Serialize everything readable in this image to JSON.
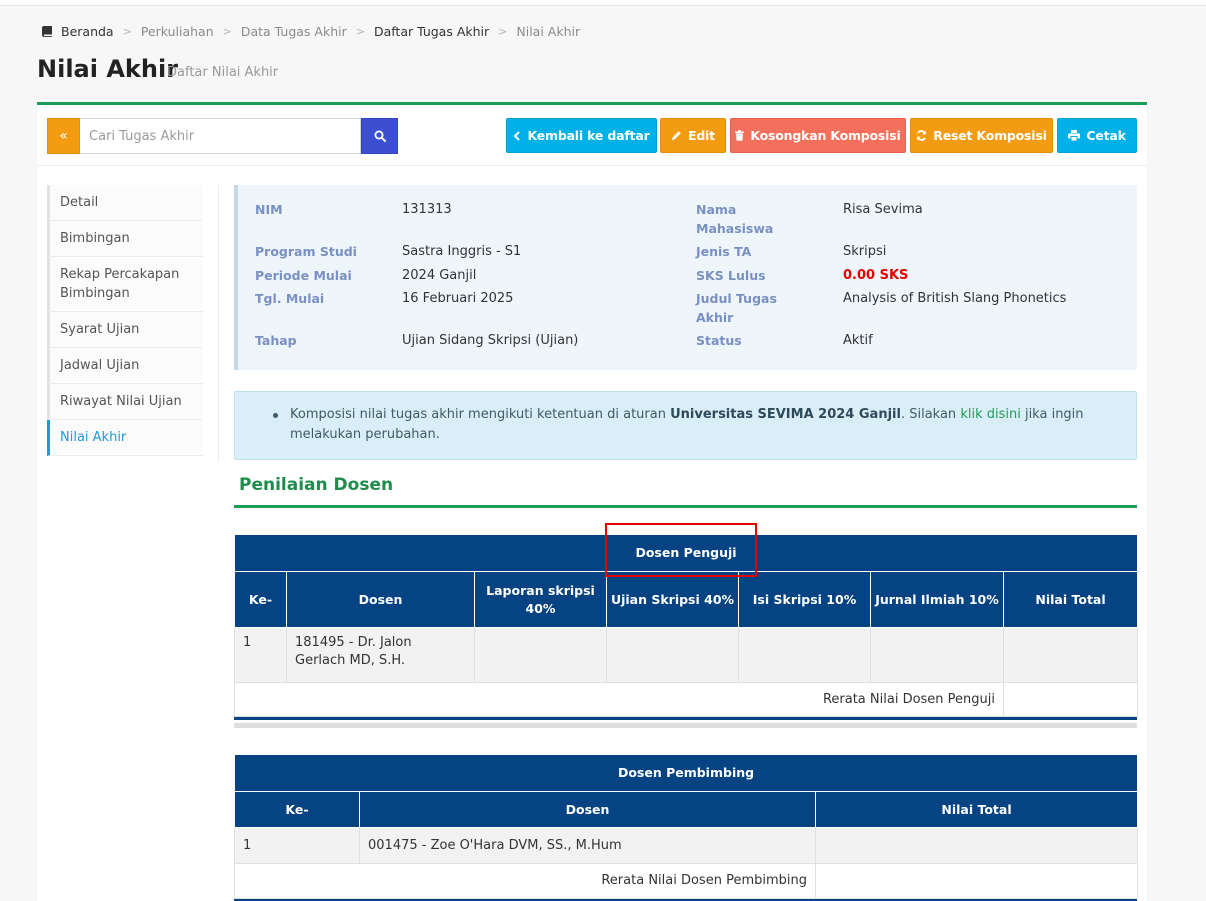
{
  "breadcrumb": {
    "items": [
      "Beranda",
      "Perkuliahan",
      "Data Tugas Akhir",
      "Daftar Tugas Akhir",
      "Nilai Akhir"
    ]
  },
  "page": {
    "title": "Nilai Akhir",
    "subtitle": "Daftar Nilai Akhir"
  },
  "toolbar": {
    "toggle_label": "«",
    "search_placeholder": "Cari Tugas Akhir",
    "search_value": "",
    "back_label": "Kembali ke daftar",
    "edit_label": "Edit",
    "kosongkan_label": "Kosongkan Komposisi",
    "reset_label": "Reset Komposisi",
    "cetak_label": "Cetak"
  },
  "sidebar": {
    "items": [
      {
        "label": "Detail"
      },
      {
        "label": "Bimbingan"
      },
      {
        "label": "Rekap Percakapan Bimbingan"
      },
      {
        "label": "Syarat Ujian"
      },
      {
        "label": "Jadwal Ujian"
      },
      {
        "label": "Riwayat Nilai Ujian"
      },
      {
        "label": "Nilai Akhir"
      }
    ],
    "active": "Nilai Akhir"
  },
  "info": {
    "nim_label": "NIM",
    "nim": "131313",
    "prodi_label": "Program Studi",
    "prodi": "Sastra Inggris - S1",
    "periode_label": "Periode Mulai",
    "periode": "2024 Ganjil",
    "tgl_label": "Tgl. Mulai",
    "tgl": "16 Februari 2025",
    "tahap_label": "Tahap",
    "tahap": "Ujian Sidang Skripsi (Ujian)",
    "nama_label": "Nama Mahasiswa",
    "nama": "Risa Sevima",
    "jenis_label": "Jenis TA",
    "jenis": "Skripsi",
    "sks_label": "SKS Lulus",
    "sks": "0.00 SKS",
    "judul_label": "Judul Tugas Akhir",
    "judul": "Analysis of British Slang Phonetics",
    "status_label": "Status",
    "status": "Aktif"
  },
  "notice": {
    "text_before": "Komposisi nilai tugas akhir mengikuti ketentuan di aturan ",
    "bold": "Universitas SEVIMA 2024 Ganjil",
    "text_mid": ". Silakan ",
    "link": "klik disini",
    "text_after": " jika ingin melakukan perubahan."
  },
  "section_title": "Penilaian Dosen",
  "penguji_table": {
    "caption": "Dosen Penguji",
    "headers": [
      "Ke-",
      "Dosen",
      "Laporan skripsi 40%",
      "Ujian Skripsi 40%",
      "Isi Skripsi 10%",
      "Jurnal Ilmiah 10%",
      "Nilai Total"
    ],
    "rows": [
      {
        "no": "1",
        "dosen": "181495 - Dr. Jalon Gerlach MD, S.H.",
        "laporan": "",
        "ujian": "",
        "isi": "",
        "jurnal": "",
        "total": ""
      }
    ],
    "footer_label": "Rerata Nilai Dosen Penguji",
    "footer_value": ""
  },
  "pembimbing_table": {
    "caption": "Dosen Pembimbing",
    "headers": [
      "Ke-",
      "Dosen",
      "Nilai Total"
    ],
    "rows": [
      {
        "no": "1",
        "dosen": "001475 - Zoe O'Hara DVM, SS., M.Hum",
        "total": ""
      }
    ],
    "footer_label": "Rerata Nilai Dosen Pembimbing",
    "footer_value": ""
  },
  "colors": {
    "primary_blue": "#064383",
    "accent_green": "#1e9c5a",
    "info_cyan": "#00b1e8",
    "warning_orange": "#f39c12",
    "danger_red": "#f4705c",
    "highlight_box": "#e60000"
  }
}
